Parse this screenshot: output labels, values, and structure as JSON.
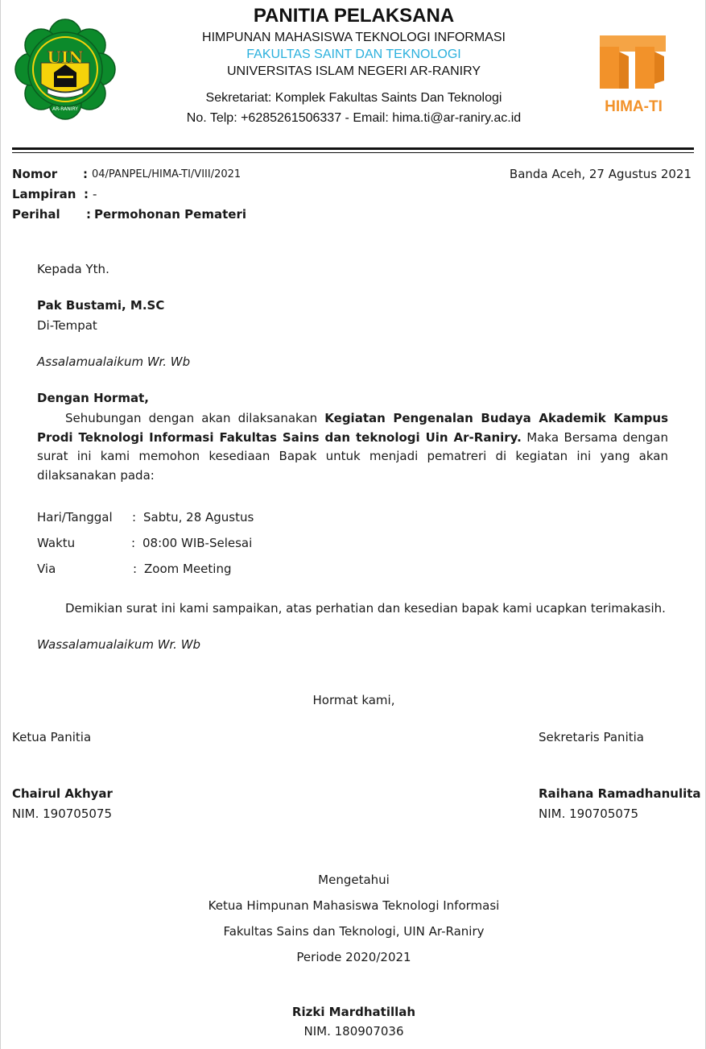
{
  "header": {
    "title": "PANITIA PELAKSANA",
    "line1": "HIMPUNAN MAHASISWA TEKNOLOGI INFORMASI",
    "line2": "FAKULTAS SAINT DAN TEKNOLOGI",
    "line3": "UNIVERSITAS ISLAM NEGERI AR-RANIRY",
    "line4": "Sekretariat: Komplek Fakultas Saints Dan Teknologi",
    "line5": "No. Telp: +6285261506337 - Email: hima.ti@ar-raniry.ac.id",
    "logo_left_text": "UIN",
    "logo_left_ring_text": "AR-RANIRY",
    "logo_right_text": "HIMA-TI",
    "colors": {
      "accent_blue": "#2ab0dd",
      "hima_orange": "#f2922a",
      "uin_green": "#0c8a2b",
      "uin_yellow": "#f5d30a"
    }
  },
  "meta": {
    "nomor_label": "Nomor",
    "nomor_value": "04/PANPEL/HIMA-TI/VIII/2021",
    "lampiran_label": "Lampiran",
    "lampiran_value": "-",
    "perihal_label": "Perihal",
    "perihal_value": "Permohonan Pemateri",
    "colon": ":",
    "date": "Banda Aceh, 27 Agustus 2021"
  },
  "recipient": {
    "kepada": "Kepada Yth.",
    "name": "Pak Bustami, M.SC",
    "place": "Di-Tempat"
  },
  "body": {
    "salam": "Assalamualaikum Wr. Wb",
    "hormat": "Dengan Hormat,",
    "para_start": "Sehubungan dengan akan dilaksanakan ",
    "para_bold": "Kegiatan Pengenalan Budaya Akademik Kampus Prodi Teknologi Informasi Fakultas Sains dan teknologi Uin Ar-Raniry.",
    "para_end": " Maka Bersama dengan surat ini kami memohon kesediaan Bapak untuk menjadi pematreri di kegiatan ini yang akan dilaksanakan pada:",
    "details": [
      {
        "label": "Hari/Tanggal",
        "value": "Sabtu, 28 Agustus"
      },
      {
        "label": "Waktu",
        "value": "08:00 WIB-Selesai"
      },
      {
        "label": "Via",
        "value": "Zoom Meeting"
      }
    ],
    "closing": "Demikian surat ini kami sampaikan, atas perhatian dan kesedian bapak kami ucapkan terimakasih.",
    "wassalam": "Wassalamualaikum Wr. Wb"
  },
  "signatures": {
    "hormat_kami": "Hormat kami,",
    "left": {
      "role": "Ketua Panitia",
      "name": "Chairul Akhyar",
      "nim": "NIM. 190705075"
    },
    "right": {
      "role": "Sekretaris Panitia",
      "name": "Raihana Ramadhanulita",
      "nim": "NIM. 190705075"
    },
    "mengetahui": "Mengetahui",
    "chair_line1": "Ketua Himpunan Mahasiswa Teknologi Informasi",
    "chair_line2": "Fakultas Sains dan Teknologi, UIN Ar-Raniry",
    "chair_line3": "Periode 2020/2021",
    "chair_name": "Rizki Mardhatillah",
    "chair_nim": "NIM. 180907036"
  }
}
